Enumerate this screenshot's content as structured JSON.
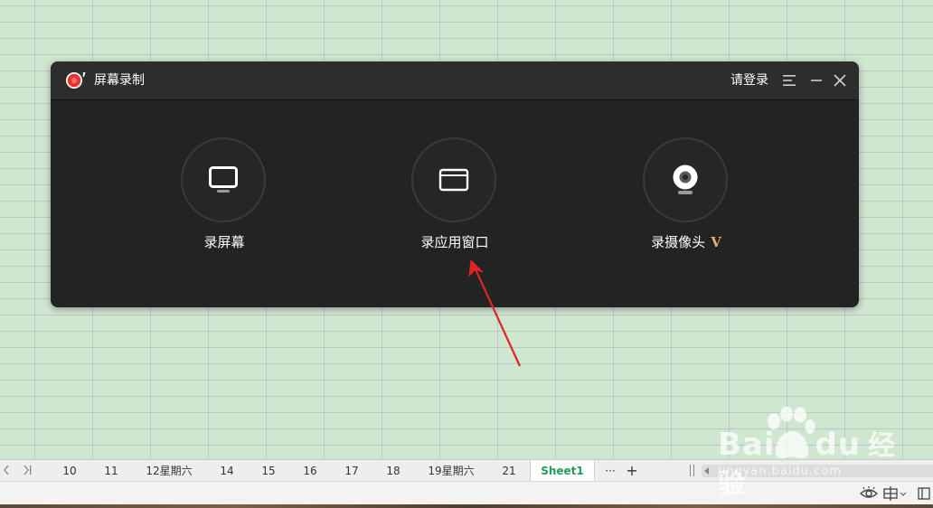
{
  "recorder": {
    "title": "屏幕录制",
    "login_label": "请登录",
    "actions": [
      {
        "label": "录屏幕"
      },
      {
        "label": "录应用窗口"
      },
      {
        "label": "录摄像头",
        "badge": "V"
      }
    ]
  },
  "sheets": {
    "tabs": [
      "10",
      "11",
      "12星期六",
      "14",
      "15",
      "16",
      "17",
      "18",
      "19星期六",
      "21",
      "Sheet1"
    ],
    "active": "Sheet1",
    "more_label": "···",
    "add_label": "+"
  },
  "watermark": {
    "brand_left": "Bai",
    "brand_right": "du",
    "brand_cn": "经验",
    "url": "jingyan.baidu.com"
  },
  "icons": {
    "app_logo": "record-icon",
    "menu": "menu-icon",
    "minimize": "minimize-icon",
    "close": "close-icon",
    "screen": "monitor-icon",
    "window": "window-icon",
    "camera": "webcam-icon",
    "first": "first-sheet-icon",
    "prev": "prev-sheet-icon",
    "eye": "eye-protection-icon",
    "grid": "grid-layout-icon"
  },
  "colors": {
    "window_bg": "#232323",
    "titlebar_bg": "#2d2d2d",
    "record_red": "#e8332d",
    "vip_gold": "#e4b06d",
    "active_tab": "#1e9b58",
    "arrow_red": "#e02424",
    "sheet_bg": "#cfe6cf"
  }
}
